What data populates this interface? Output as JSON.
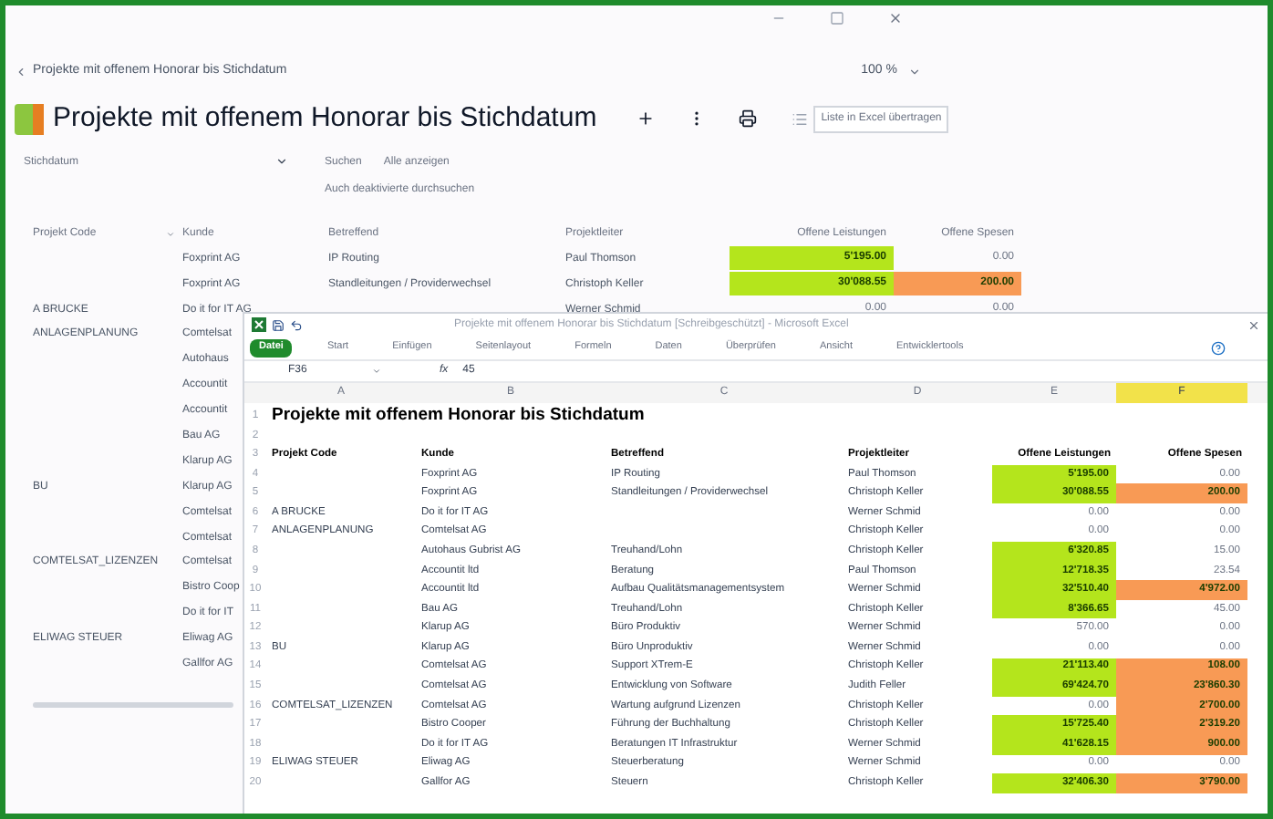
{
  "breadcrumb": "Projekte mit offenem Honorar bis Stichdatum",
  "zoom": "100 %",
  "title": "Projekte mit offenem Honorar bis Stichdatum",
  "tooltip": "Liste in Excel übertragen",
  "filter": {
    "date_label": "Stichdatum",
    "search": "Suchen",
    "show_all": "Alle anzeigen",
    "include_deactivated": "Auch deaktivierte durchsuchen"
  },
  "list": {
    "columns": [
      "Projekt Code",
      "Kunde",
      "Betreffend",
      "Projektleiter",
      "Offene Leistungen",
      "Offene Spesen"
    ],
    "rows": [
      {
        "kunde": "Foxprint AG",
        "betreffend": "IP Routing",
        "leiter": "Paul Thomson",
        "leistungen": {
          "text": "5'195.00",
          "color": "#b4e51c"
        },
        "spesen": {
          "text": "0.00"
        }
      },
      {
        "kunde": "Foxprint AG",
        "betreffend": "Standleitungen / Providerwechsel",
        "leiter": "Christoph Keller",
        "leistungen": {
          "text": "30'088.55",
          "color": "#b4e51c"
        },
        "spesen": {
          "text": "200.00",
          "color": "#f89a55"
        }
      },
      {
        "code": "A BRUCKE",
        "kunde": "Do it for IT AG",
        "leiter": "Werner Schmid",
        "leistungen": {
          "text": "0.00"
        },
        "spesen": {
          "text": "0.00"
        }
      }
    ],
    "partial_rows": [
      {
        "code": "ANLAGENPLANUNG",
        "kunde": "Comtelsat"
      },
      {
        "kunde": "Autohaus"
      },
      {
        "kunde": "Accountit"
      },
      {
        "kunde": "Accountit"
      },
      {
        "kunde": "Bau AG"
      },
      {
        "kunde": "Klarup AG"
      },
      {
        "code": "BU",
        "kunde": "Klarup AG"
      },
      {
        "kunde": "Comtelsat"
      },
      {
        "kunde": "Comtelsat"
      },
      {
        "code": "COMTELSAT_LIZENZEN",
        "kunde": "Comtelsat"
      },
      {
        "kunde": "Bistro Coop"
      },
      {
        "kunde": "Do it for IT"
      },
      {
        "code": "ELIWAG STEUER",
        "kunde": "Eliwag AG"
      },
      {
        "kunde": "Gallfor AG"
      }
    ]
  },
  "excel": {
    "title": "Projekte mit offenem Honorar bis Stichdatum [Schreibgeschützt] - Microsoft Excel",
    "ribbon_tabs": [
      {
        "label": "Datei",
        "selected": true
      },
      {
        "label": "Start",
        "selected": false
      },
      {
        "label": "Einfügen",
        "selected": false
      },
      {
        "label": "Seitenlayout",
        "selected": false
      },
      {
        "label": "Formeln",
        "selected": false
      },
      {
        "label": "Daten",
        "selected": false
      },
      {
        "label": "Überprüfen",
        "selected": false
      },
      {
        "label": "Ansicht",
        "selected": false
      },
      {
        "label": "Entwicklertools",
        "selected": false
      }
    ],
    "name_box": "F36",
    "function_label": "fx",
    "formula": "45",
    "columns": [
      {
        "label": "A",
        "selected": false
      },
      {
        "label": "B",
        "selected": false
      },
      {
        "label": "C",
        "selected": false
      },
      {
        "label": "D",
        "selected": false
      },
      {
        "label": "E",
        "selected": false
      },
      {
        "label": "F",
        "selected": true
      }
    ],
    "row_labels": [
      "1",
      "2",
      "3"
    ],
    "sheet_title": "Projekte mit offenem Honorar bis Stichdatum",
    "headers": [
      "Projekt Code",
      "Kunde",
      "Betreffend",
      "Projektleiter",
      "Offene Leistungen",
      "Offene Spesen"
    ],
    "rows": [
      {
        "num": "4",
        "kunde": "Foxprint AG",
        "betreffend": "IP Routing",
        "leiter": "Paul Thomson",
        "leistungen": {
          "text": "5'195.00",
          "color": "#b4e51c"
        },
        "spesen": {
          "text": "0.00"
        }
      },
      {
        "num": "5",
        "kunde": "Foxprint AG",
        "betreffend": "Standleitungen / Providerwechsel",
        "leiter": "Christoph Keller",
        "leistungen": {
          "text": "30'088.55",
          "color": "#b4e51c"
        },
        "spesen": {
          "text": "200.00",
          "color": "#f89a55"
        }
      },
      {
        "num": "6",
        "code": "A BRUCKE",
        "kunde": "Do it for IT AG",
        "leiter": "Werner Schmid",
        "leistungen": {
          "text": "0.00"
        },
        "spesen": {
          "text": "0.00"
        }
      },
      {
        "num": "7",
        "code": "ANLAGENPLANUNG",
        "kunde": "Comtelsat AG",
        "leiter": "Christoph Keller",
        "leistungen": {
          "text": "0.00"
        },
        "spesen": {
          "text": "0.00"
        }
      },
      {
        "num": "8",
        "kunde": "Autohaus Gubrist AG",
        "betreffend": "Treuhand/Lohn",
        "leiter": "Christoph Keller",
        "leistungen": {
          "text": "6'320.85",
          "color": "#b4e51c"
        },
        "spesen": {
          "text": "15.00"
        }
      },
      {
        "num": "9",
        "kunde": "Accountit ltd",
        "betreffend": "Beratung",
        "leiter": "Paul Thomson",
        "leistungen": {
          "text": "12'718.35",
          "color": "#b4e51c"
        },
        "spesen": {
          "text": "23.54"
        }
      },
      {
        "num": "10",
        "kunde": "Accountit ltd",
        "betreffend": "Aufbau Qualitätsmanagementsystem",
        "leiter": "Werner Schmid",
        "leistungen": {
          "text": "32'510.40",
          "color": "#b4e51c"
        },
        "spesen": {
          "text": "4'972.00",
          "color": "#f89a55"
        }
      },
      {
        "num": "11",
        "kunde": "Bau AG",
        "betreffend": "Treuhand/Lohn",
        "leiter": "Christoph Keller",
        "leistungen": {
          "text": "8'366.65",
          "color": "#b4e51c"
        },
        "spesen": {
          "text": "45.00"
        }
      },
      {
        "num": "12",
        "kunde": "Klarup AG",
        "betreffend": "Büro Produktiv",
        "leiter": "Werner Schmid",
        "leistungen": {
          "text": "570.00"
        },
        "spesen": {
          "text": "0.00"
        }
      },
      {
        "num": "13",
        "code": "BU",
        "kunde": "Klarup AG",
        "betreffend": "Büro Unproduktiv",
        "leiter": "Werner Schmid",
        "leistungen": {
          "text": "0.00"
        },
        "spesen": {
          "text": "0.00"
        }
      },
      {
        "num": "14",
        "kunde": "Comtelsat AG",
        "betreffend": "Support XTrem-E",
        "leiter": "Christoph Keller",
        "leistungen": {
          "text": "21'113.40",
          "color": "#b4e51c"
        },
        "spesen": {
          "text": "108.00",
          "color": "#f89a55"
        }
      },
      {
        "num": "15",
        "kunde": "Comtelsat AG",
        "betreffend": "Entwicklung von Software",
        "leiter": "Judith Feller",
        "leistungen": {
          "text": "69'424.70",
          "color": "#b4e51c"
        },
        "spesen": {
          "text": "23'860.30",
          "color": "#f89a55"
        }
      },
      {
        "num": "16",
        "code": "COMTELSAT_LIZENZEN",
        "kunde": "Comtelsat AG",
        "betreffend": "Wartung aufgrund Lizenzen",
        "leiter": "Christoph Keller",
        "leistungen": {
          "text": "0.00"
        },
        "spesen": {
          "text": "2'700.00",
          "color": "#f89a55"
        }
      },
      {
        "num": "17",
        "kunde": "Bistro Cooper",
        "betreffend": "Führung der Buchhaltung",
        "leiter": "Christoph Keller",
        "leistungen": {
          "text": "15'725.40",
          "color": "#b4e51c"
        },
        "spesen": {
          "text": "2'319.20",
          "color": "#f89a55"
        }
      },
      {
        "num": "18",
        "kunde": "Do it for IT AG",
        "betreffend": "Beratungen IT Infrastruktur",
        "leiter": "Werner Schmid",
        "leistungen": {
          "text": "41'628.15",
          "color": "#b4e51c"
        },
        "spesen": {
          "text": "900.00",
          "color": "#f89a55"
        }
      },
      {
        "num": "19",
        "code": "ELIWAG STEUER",
        "kunde": "Eliwag AG",
        "betreffend": "Steuerberatung",
        "leiter": "Werner Schmid",
        "leistungen": {
          "text": "0.00"
        },
        "spesen": {
          "text": "0.00"
        }
      },
      {
        "num": "20",
        "kunde": "Gallfor AG",
        "betreffend": "Steuern",
        "leiter": "Christoph Keller",
        "leistungen": {
          "text": "32'406.30",
          "color": "#b4e51c"
        },
        "spesen": {
          "text": "3'790.00",
          "color": "#f89a55"
        }
      }
    ]
  }
}
